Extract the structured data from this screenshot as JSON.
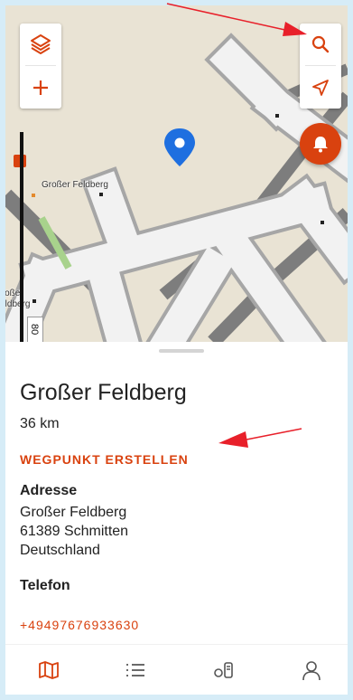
{
  "map": {
    "labels": {
      "peak": "Großer Feldberg",
      "left": "Großer Feldberg"
    },
    "scale_text": "80",
    "colors": {
      "accent": "#d9420f",
      "pin": "#1e6fe0"
    },
    "buttons": {
      "layers": "layers-icon",
      "zoom_in": "plus-icon",
      "search": "search-icon",
      "locate": "navigation-arrow-icon",
      "alarm": "bell-icon"
    }
  },
  "sheet": {
    "title": "Großer Feldberg",
    "distance": "36 km",
    "create_waypoint": "WEGPUNKT ERSTELLEN",
    "address_label": "Adresse",
    "address_line1": "Großer Feldberg",
    "address_line2": "61389 Schmitten",
    "address_line3": "Deutschland",
    "phone_label": "Telefon",
    "phone": "+49497676933630"
  },
  "nav": {
    "items": [
      "map-icon",
      "list-icon",
      "watch-device-icon",
      "profile-icon"
    ],
    "active": "map-icon"
  }
}
